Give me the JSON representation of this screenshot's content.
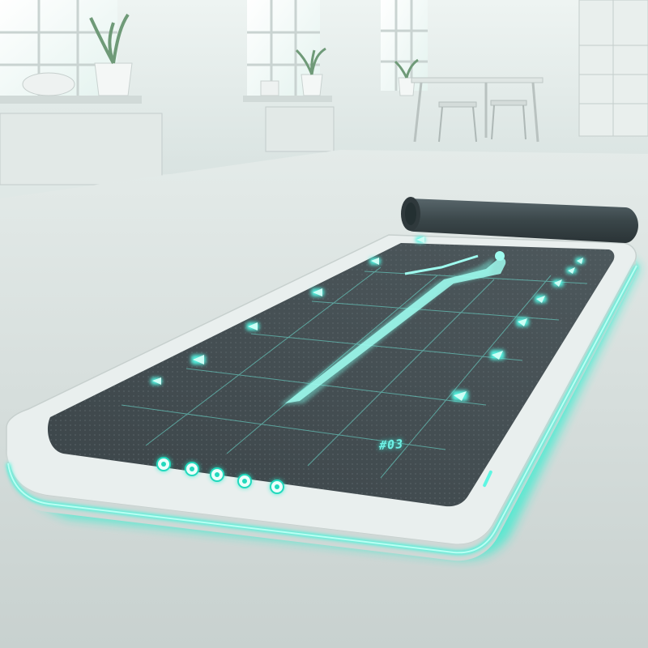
{
  "scene": {
    "subject": "smart-yoga-mat",
    "accent_color": "#22f0cf",
    "mat_surface_color": "#3a4347",
    "frame_color": "#e9efee",
    "floor_color": "#d3dbd9",
    "wall_color": "#e6eeec"
  },
  "mat": {
    "display_readout": "#03",
    "control_buttons": [
      {
        "icon": "ring-dot-icon"
      },
      {
        "icon": "ring-dot-icon"
      },
      {
        "icon": "ring-dot-icon"
      },
      {
        "icon": "ring-dot-icon"
      },
      {
        "icon": "ring-dot-icon"
      }
    ]
  }
}
